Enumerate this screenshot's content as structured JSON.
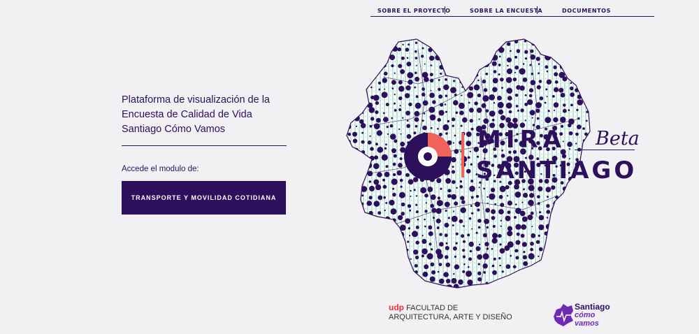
{
  "nav": {
    "items": [
      {
        "label": "SOBRE EL PROYECTO"
      },
      {
        "label": "SOBRE LA ENCUESTA"
      },
      {
        "label": "DOCUMENTOS"
      }
    ]
  },
  "intro": {
    "lines": [
      "Plataforma de visualización de la",
      "Encuesta de Calidad de Vida",
      "Santiago Cómo Vamos"
    ],
    "prompt": "Accede el modulo de:",
    "button_label": "TRANSPORTE Y MOVILIDAD COTIDIANA"
  },
  "logo": {
    "line1": "MIRA",
    "line2": "SANTIAGO",
    "tag": "Beta"
  },
  "footer": {
    "udp_mark": "udp",
    "udp_line1": "FACULTAD DE",
    "udp_line2": "ARQUITECTURA, ARTE Y DISEÑO",
    "partner_line1": "Santiago",
    "partner_line2": "cómo",
    "partner_line3": "vamos"
  },
  "colors": {
    "primary": "#2d0f5c",
    "accent": "#f0625a",
    "background": "#f1f0f2",
    "map_hatch": "#7fc9b8",
    "udp_red": "#e63338"
  }
}
